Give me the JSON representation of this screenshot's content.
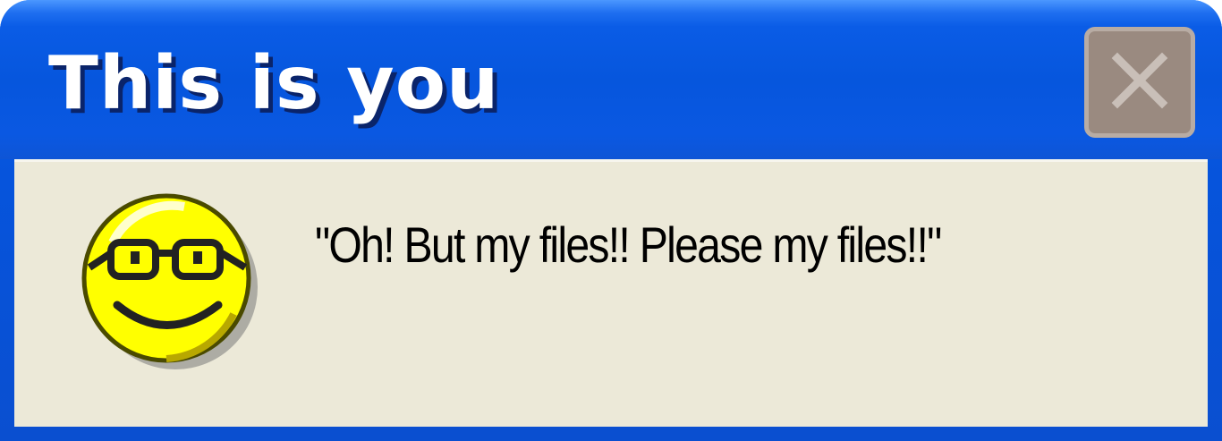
{
  "window": {
    "title": "This is you",
    "close_icon": "close-icon",
    "message": "\"Oh! But my files!! Please my files!!\"",
    "message_icon": "smiley-glasses-icon"
  },
  "colors": {
    "titlebar": "#0654dc",
    "body": "#ece9d8",
    "close_button": "#9a8a80",
    "face": "#ffff00"
  }
}
